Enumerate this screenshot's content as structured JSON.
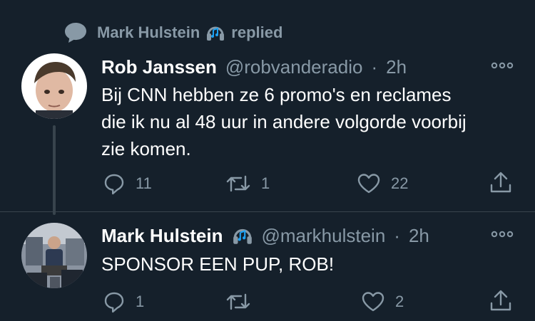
{
  "social_context": {
    "name": "Mark Hulstein",
    "action": "replied"
  },
  "tweets": [
    {
      "name": "Rob Janssen",
      "handle": "@robvanderadio",
      "dot": "·",
      "time": "2h",
      "text_lines": [
        "Bij CNN hebben ze 6 promo's en reclames",
        "die ik nu al 48 uur in andere volgorde voorbij",
        "zie komen."
      ],
      "replies": "11",
      "retweets": "1",
      "likes": "22"
    },
    {
      "name": "Mark Hulstein",
      "handle": "@markhulstein",
      "dot": "·",
      "time": "2h",
      "text_lines": [
        "SPONSOR EEN PUP, ROB!"
      ],
      "replies": "1",
      "retweets": "",
      "likes": "2"
    }
  ],
  "colors": {
    "background": "#15202b",
    "secondary_text": "#8899a6",
    "thread_line": "#38444d",
    "headphones": "#1da1f2"
  },
  "icons": [
    "speech-bubble-icon",
    "headphones-emoji-icon",
    "more-icon",
    "reply-icon",
    "retweet-icon",
    "like-icon",
    "share-icon"
  ]
}
